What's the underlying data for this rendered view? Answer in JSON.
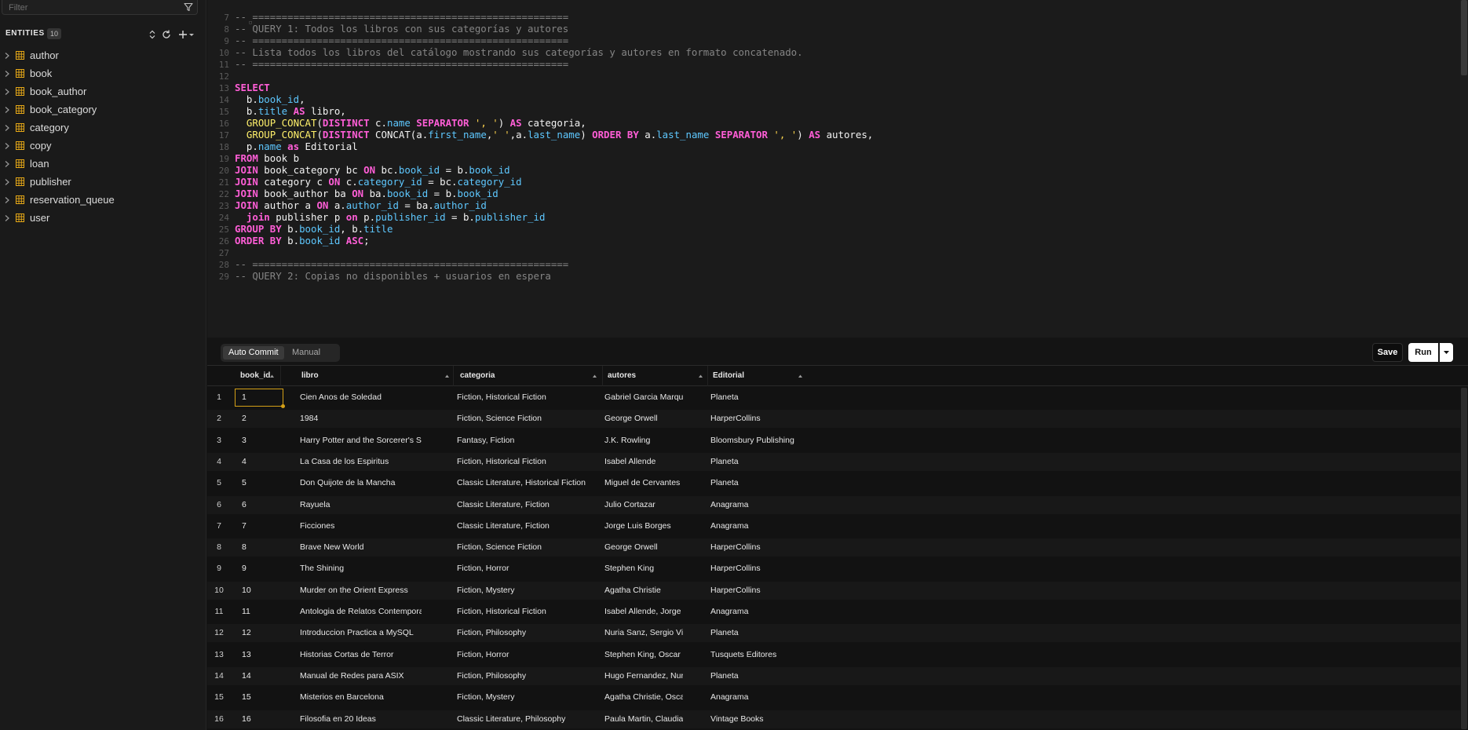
{
  "sidebar": {
    "filter_placeholder": "Filter",
    "entities_title": "ENTITIES",
    "entities_count": "10",
    "items": [
      {
        "label": "author"
      },
      {
        "label": "book"
      },
      {
        "label": "book_author"
      },
      {
        "label": "book_category"
      },
      {
        "label": "category"
      },
      {
        "label": "copy"
      },
      {
        "label": "loan"
      },
      {
        "label": "publisher"
      },
      {
        "label": "reservation_queue"
      },
      {
        "label": "user"
      }
    ]
  },
  "editor": {
    "lines": [
      {
        "n": "7",
        "tokens": [
          [
            "cm",
            "-- ======================================================"
          ]
        ]
      },
      {
        "n": "8",
        "tokens": [
          [
            "cm",
            "-- QUERY 1: Todos los libros con sus categorías y autores"
          ]
        ]
      },
      {
        "n": "9",
        "tokens": [
          [
            "cm",
            "-- ======================================================"
          ]
        ]
      },
      {
        "n": "10",
        "tokens": [
          [
            "cm",
            "-- Lista todos los libros del catálogo mostrando sus categorías y autores en formato concatenado."
          ]
        ]
      },
      {
        "n": "11",
        "tokens": [
          [
            "cm",
            "-- ======================================================"
          ]
        ]
      },
      {
        "n": "12",
        "tokens": []
      },
      {
        "n": "13",
        "tokens": [
          [
            "kw",
            "SELECT"
          ]
        ]
      },
      {
        "n": "14",
        "tokens": [
          [
            "id",
            "  b."
          ],
          [
            "col",
            "book_id"
          ],
          [
            "id",
            ","
          ]
        ]
      },
      {
        "n": "15",
        "tokens": [
          [
            "id",
            "  b."
          ],
          [
            "col",
            "title"
          ],
          [
            "id",
            " "
          ],
          [
            "kw",
            "AS"
          ],
          [
            "id",
            " libro,"
          ]
        ]
      },
      {
        "n": "16",
        "tokens": [
          [
            "fn",
            "  GROUP_CONCAT"
          ],
          [
            "id",
            "("
          ],
          [
            "kw",
            "DISTINCT"
          ],
          [
            "id",
            " c."
          ],
          [
            "col",
            "name"
          ],
          [
            "id",
            " "
          ],
          [
            "kw",
            "SEPARATOR"
          ],
          [
            "id",
            " "
          ],
          [
            "str",
            "', '"
          ],
          [
            "id",
            ") "
          ],
          [
            "kw",
            "AS"
          ],
          [
            "id",
            " categoria,"
          ]
        ]
      },
      {
        "n": "17",
        "tokens": [
          [
            "fn",
            "  GROUP_CONCAT"
          ],
          [
            "id",
            "("
          ],
          [
            "kw",
            "DISTINCT"
          ],
          [
            "id",
            " CONCAT(a."
          ],
          [
            "col",
            "first_name"
          ],
          [
            "id",
            ","
          ],
          [
            "str",
            "' '"
          ],
          [
            "id",
            ",a."
          ],
          [
            "col",
            "last_name"
          ],
          [
            "id",
            ") "
          ],
          [
            "kw",
            "ORDER BY"
          ],
          [
            "id",
            " a."
          ],
          [
            "col",
            "last_name"
          ],
          [
            "id",
            " "
          ],
          [
            "kw",
            "SEPARATOR"
          ],
          [
            "id",
            " "
          ],
          [
            "str",
            "', '"
          ],
          [
            "id",
            ") "
          ],
          [
            "kw",
            "AS"
          ],
          [
            "id",
            " autores,"
          ]
        ]
      },
      {
        "n": "18",
        "tokens": [
          [
            "id",
            "  p."
          ],
          [
            "col",
            "name"
          ],
          [
            "id",
            " "
          ],
          [
            "kw",
            "as"
          ],
          [
            "id",
            " Editorial"
          ]
        ]
      },
      {
        "n": "19",
        "tokens": [
          [
            "kw",
            "FROM"
          ],
          [
            "id",
            " book b"
          ]
        ]
      },
      {
        "n": "20",
        "tokens": [
          [
            "kw",
            "JOIN"
          ],
          [
            "id",
            " book_category bc "
          ],
          [
            "kw",
            "ON"
          ],
          [
            "id",
            " bc."
          ],
          [
            "col",
            "book_id"
          ],
          [
            "id",
            " = b."
          ],
          [
            "col",
            "book_id"
          ]
        ]
      },
      {
        "n": "21",
        "tokens": [
          [
            "kw",
            "JOIN"
          ],
          [
            "id",
            " category c "
          ],
          [
            "kw",
            "ON"
          ],
          [
            "id",
            " c."
          ],
          [
            "col",
            "category_id"
          ],
          [
            "id",
            " = bc."
          ],
          [
            "col",
            "category_id"
          ]
        ]
      },
      {
        "n": "22",
        "tokens": [
          [
            "kw",
            "JOIN"
          ],
          [
            "id",
            " book_author ba "
          ],
          [
            "kw",
            "ON"
          ],
          [
            "id",
            " ba."
          ],
          [
            "col",
            "book_id"
          ],
          [
            "id",
            " = b."
          ],
          [
            "col",
            "book_id"
          ]
        ]
      },
      {
        "n": "23",
        "tokens": [
          [
            "kw",
            "JOIN"
          ],
          [
            "id",
            " author a "
          ],
          [
            "kw",
            "ON"
          ],
          [
            "id",
            " a."
          ],
          [
            "col",
            "author_id"
          ],
          [
            "id",
            " = ba."
          ],
          [
            "col",
            "author_id"
          ]
        ]
      },
      {
        "n": "24",
        "tokens": [
          [
            "id",
            "  "
          ],
          [
            "kw",
            "join"
          ],
          [
            "id",
            " publisher p "
          ],
          [
            "kw",
            "on"
          ],
          [
            "id",
            " p."
          ],
          [
            "col",
            "publisher_id"
          ],
          [
            "id",
            " = b."
          ],
          [
            "col",
            "publisher_id"
          ]
        ]
      },
      {
        "n": "25",
        "tokens": [
          [
            "kw",
            "GROUP BY"
          ],
          [
            "id",
            " b."
          ],
          [
            "col",
            "book_id"
          ],
          [
            "id",
            ", b."
          ],
          [
            "col",
            "title"
          ]
        ]
      },
      {
        "n": "26",
        "tokens": [
          [
            "kw",
            "ORDER BY"
          ],
          [
            "id",
            " b."
          ],
          [
            "col",
            "book_id"
          ],
          [
            "id",
            " "
          ],
          [
            "kw",
            "ASC"
          ],
          [
            "id",
            ";"
          ]
        ]
      },
      {
        "n": "27",
        "tokens": []
      },
      {
        "n": "28",
        "tokens": [
          [
            "cm",
            "-- ======================================================"
          ]
        ]
      },
      {
        "n": "29",
        "tokens": [
          [
            "cm",
            "-- QUERY 2: Copias no disponibles + usuarios en espera"
          ]
        ]
      }
    ]
  },
  "toolbar": {
    "auto_commit": "Auto Commit",
    "manual": "Manual",
    "save": "Save",
    "run": "Run"
  },
  "grid": {
    "columns": [
      "book_id",
      "libro",
      "categoria",
      "autores",
      "Editorial"
    ],
    "rows": [
      [
        "1",
        "1",
        "Cien Anos de Soledad",
        "Fiction, Historical Fiction",
        "Gabriel Garcia Marquez",
        "Planeta"
      ],
      [
        "2",
        "2",
        "1984",
        "Fiction, Science Fiction",
        "George Orwell",
        "HarperCollins"
      ],
      [
        "3",
        "3",
        "Harry Potter and the Sorcerer's Stone",
        "Fantasy, Fiction",
        "J.K. Rowling",
        "Bloomsbury Publishing"
      ],
      [
        "4",
        "4",
        "La Casa de los Espiritus",
        "Fiction, Historical Fiction",
        "Isabel Allende",
        "Planeta"
      ],
      [
        "5",
        "5",
        "Don Quijote de la Mancha",
        "Classic Literature, Historical Fiction",
        "Miguel de Cervantes",
        "Planeta"
      ],
      [
        "6",
        "6",
        "Rayuela",
        "Classic Literature, Fiction",
        "Julio Cortazar",
        "Anagrama"
      ],
      [
        "7",
        "7",
        "Ficciones",
        "Classic Literature, Fiction",
        "Jorge Luis Borges",
        "Anagrama"
      ],
      [
        "8",
        "8",
        "Brave New World",
        "Fiction, Science Fiction",
        "George Orwell",
        "HarperCollins"
      ],
      [
        "9",
        "9",
        "The Shining",
        "Fiction, Horror",
        "Stephen King",
        "HarperCollins"
      ],
      [
        "10",
        "10",
        "Murder on the Orient Express",
        "Fiction, Mystery",
        "Agatha Christie",
        "HarperCollins"
      ],
      [
        "11",
        "11",
        "Antologia de Relatos Contemporan...",
        "Fiction, Historical Fiction",
        "Isabel Allende, Jorge ...",
        "Anagrama"
      ],
      [
        "12",
        "12",
        "Introduccion Practica a MySQL",
        "Fiction, Philosophy",
        "Nuria Sanz, Sergio Vi...",
        "Planeta"
      ],
      [
        "13",
        "13",
        "Historias Cortas de Terror",
        "Fiction, Horror",
        "Stephen King, Oscar S...",
        "Tusquets Editores"
      ],
      [
        "14",
        "14",
        "Manual de Redes para ASIX",
        "Fiction, Philosophy",
        "Hugo Fernandez, Nur...",
        "Planeta"
      ],
      [
        "15",
        "15",
        "Misterios en Barcelona",
        "Fiction, Mystery",
        "Agatha Christie, Osca...",
        "Anagrama"
      ],
      [
        "16",
        "16",
        "Filosofia en 20 Ideas",
        "Classic Literature, Philosophy",
        "Paula Martin, Claudia ...",
        "Vintage Books"
      ]
    ]
  },
  "colors": {
    "accent_entity_icon": "#e6a817",
    "selected_cell_border": "#d4a017",
    "keyword": "#ff5ed7",
    "column": "#5ec8ff",
    "string": "#ffd54d",
    "function": "#fff06b",
    "comment": "#858585"
  }
}
